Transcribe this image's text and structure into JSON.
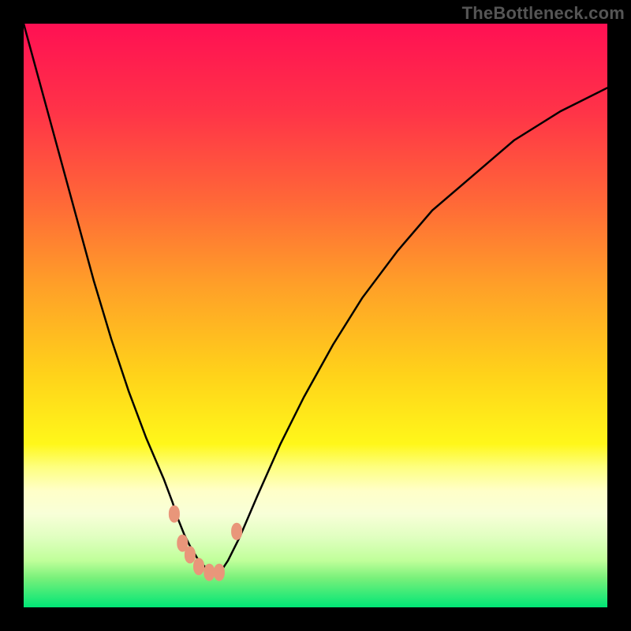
{
  "watermark": "TheBottleneck.com",
  "chart_data": {
    "type": "line",
    "title": "",
    "xlabel": "",
    "ylabel": "",
    "xlim": [
      0,
      100
    ],
    "ylim": [
      0,
      100
    ],
    "grid": false,
    "legend_position": "none",
    "gradient_stops": [
      {
        "pos": 0.0,
        "color": "#ff1053"
      },
      {
        "pos": 0.15,
        "color": "#ff3348"
      },
      {
        "pos": 0.3,
        "color": "#ff6638"
      },
      {
        "pos": 0.45,
        "color": "#ffa028"
      },
      {
        "pos": 0.6,
        "color": "#ffd21a"
      },
      {
        "pos": 0.72,
        "color": "#fff71a"
      },
      {
        "pos": 0.76,
        "color": "#feff80"
      },
      {
        "pos": 0.8,
        "color": "#ffffc8"
      },
      {
        "pos": 0.84,
        "color": "#f8ffd8"
      },
      {
        "pos": 0.88,
        "color": "#e0ffc0"
      },
      {
        "pos": 0.92,
        "color": "#c0ff9a"
      },
      {
        "pos": 0.95,
        "color": "#78f07a"
      },
      {
        "pos": 1.0,
        "color": "#00e676"
      }
    ],
    "series": [
      {
        "name": "bottleneck-curve",
        "color": "#000000",
        "x": [
          0,
          3,
          6,
          9,
          12,
          15,
          18,
          21,
          24,
          25.5,
          26.5,
          27.5,
          28.5,
          30,
          31.5,
          33,
          34,
          35,
          37,
          40,
          44,
          48,
          53,
          58,
          64,
          70,
          77,
          84,
          92,
          100
        ],
        "y": [
          100,
          89,
          78,
          67,
          56,
          46,
          37,
          29,
          22,
          18,
          15,
          12.5,
          10.5,
          8,
          6.5,
          6,
          6.5,
          8,
          12,
          19,
          28,
          36,
          45,
          53,
          61,
          68,
          74,
          80,
          85,
          89
        ]
      }
    ],
    "markers": [
      {
        "name": "marker-a",
        "x": 25.8,
        "y": 16,
        "color": "#e9967a"
      },
      {
        "name": "marker-b",
        "x": 27.2,
        "y": 11,
        "color": "#e9967a"
      },
      {
        "name": "marker-c",
        "x": 28.5,
        "y": 9,
        "color": "#e9967a"
      },
      {
        "name": "marker-d",
        "x": 30.0,
        "y": 7,
        "color": "#e9967a"
      },
      {
        "name": "marker-e",
        "x": 31.8,
        "y": 6,
        "color": "#e9967a"
      },
      {
        "name": "marker-f",
        "x": 33.5,
        "y": 6,
        "color": "#e9967a"
      },
      {
        "name": "marker-g",
        "x": 36.5,
        "y": 13,
        "color": "#e9967a"
      }
    ]
  }
}
